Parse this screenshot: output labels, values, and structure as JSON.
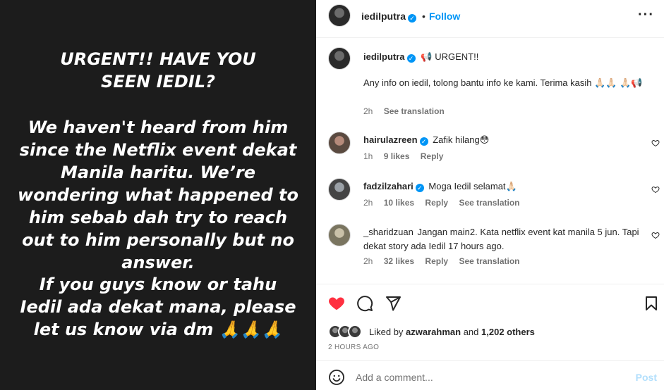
{
  "image_text": {
    "heading": "URGENT!! HAVE YOU SEEN IEDIL?",
    "body": "We haven't heard from him since the Netflix event dekat Manila haritu. We’re wondering what happened to him sebab dah try to reach out to him personally but no answer.",
    "footer": "If you guys know or tahu Iedil ada dekat mana, please let us know via dm 🙏🙏🙏"
  },
  "header": {
    "username": "iedilputra",
    "separator": "•",
    "follow_label": "Follow",
    "more_label": "···"
  },
  "caption": {
    "username": "iedilputra",
    "line1": "📢 URGENT!!",
    "line2": "Any info on iedil, tolong bantu info ke kami. Terima kasih 🙏🏻🙏🏻 🙏🏻📢",
    "time": "2h",
    "see_translation": "See translation"
  },
  "comments": [
    {
      "username": "hairulazreen",
      "text": "Zafik hilang😳",
      "time": "1h",
      "likes": "9 likes",
      "reply": "Reply",
      "see_translation": ""
    },
    {
      "username": "fadzilzahari",
      "text": "Moga Iedil selamat🙏🏻",
      "time": "2h",
      "likes": "10 likes",
      "reply": "Reply",
      "see_translation": "See translation"
    },
    {
      "username": "_sharidzuan",
      "text": "Jangan main2. Kata netflix event kat manila 5 jun. Tapi dekat story ada Iedil 17 hours ago.",
      "time": "2h",
      "likes": "32 likes",
      "reply": "Reply",
      "see_translation": "See translation"
    }
  ],
  "actions": {
    "liked_prefix": "Liked by ",
    "liked_user": "azwarahman",
    "liked_and": " and ",
    "liked_count": "1,202 others",
    "time_ago": "2 HOURS AGO"
  },
  "add_comment": {
    "placeholder": "Add a comment...",
    "post_label": "Post"
  },
  "colors": {
    "accent": "#0095f6",
    "like_red": "#ff3040",
    "image_bg": "#1c1c1c"
  }
}
